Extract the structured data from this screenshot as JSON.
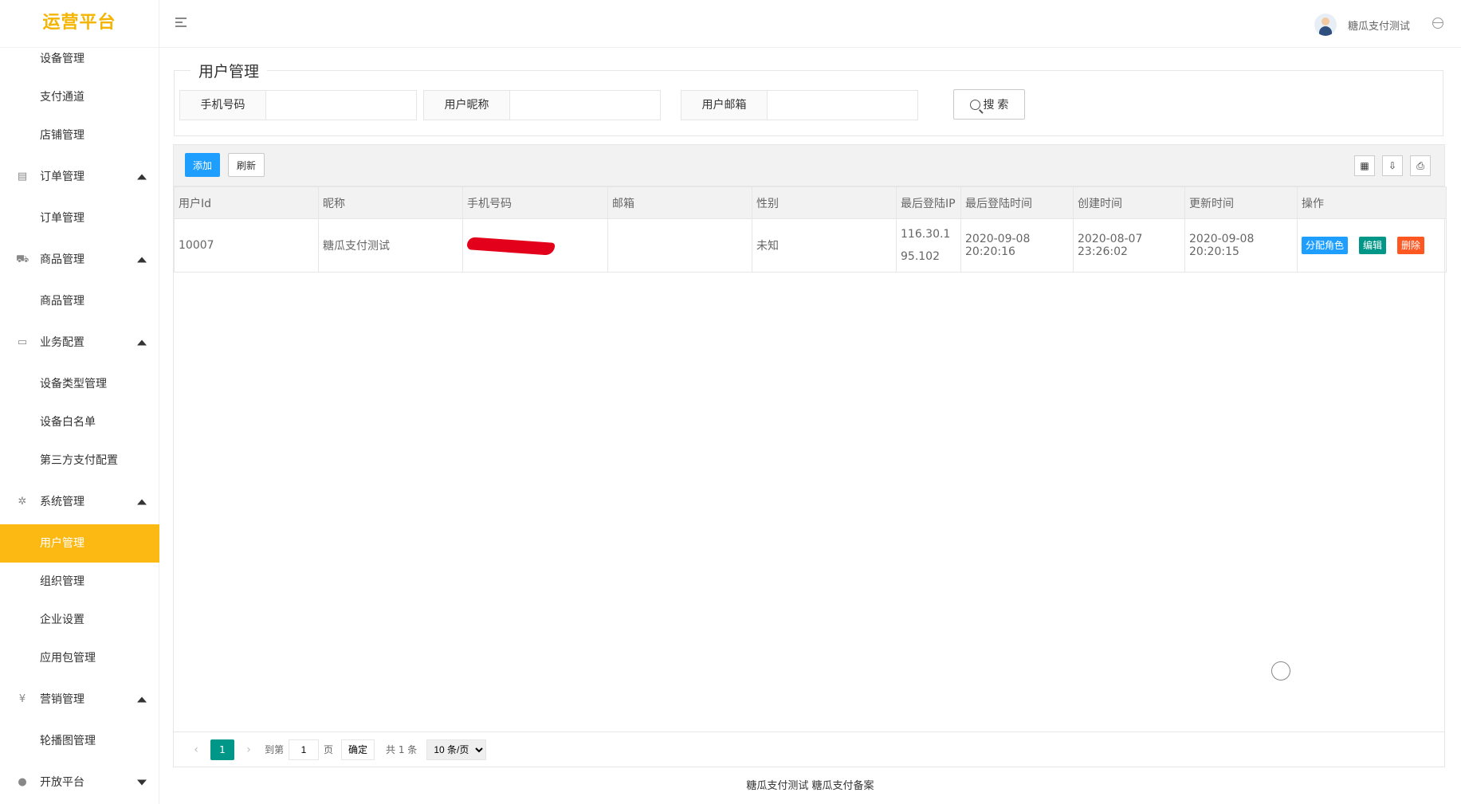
{
  "app": {
    "logo": "运营平台"
  },
  "header": {
    "username": "糖瓜支付测试"
  },
  "sidebar": {
    "items": [
      {
        "label": "设备管理",
        "type": "sub"
      },
      {
        "label": "支付通道",
        "type": "sub"
      },
      {
        "label": "店铺管理",
        "type": "sub"
      },
      {
        "label": "订单管理",
        "type": "group",
        "icon": "clipboard-icon",
        "arrow": "up"
      },
      {
        "label": "订单管理",
        "type": "sub"
      },
      {
        "label": "商品管理",
        "type": "group",
        "icon": "cart-icon",
        "arrow": "up"
      },
      {
        "label": "商品管理",
        "type": "sub"
      },
      {
        "label": "业务配置",
        "type": "group",
        "icon": "book-icon",
        "arrow": "up"
      },
      {
        "label": "设备类型管理",
        "type": "sub"
      },
      {
        "label": "设备白名单",
        "type": "sub"
      },
      {
        "label": "第三方支付配置",
        "type": "sub"
      },
      {
        "label": "系统管理",
        "type": "group",
        "icon": "gear-icon",
        "arrow": "up"
      },
      {
        "label": "用户管理",
        "type": "sub",
        "active": true
      },
      {
        "label": "组织管理",
        "type": "sub"
      },
      {
        "label": "企业设置",
        "type": "sub"
      },
      {
        "label": "应用包管理",
        "type": "sub"
      },
      {
        "label": "营销管理",
        "type": "group",
        "icon": "yen-icon",
        "arrow": "up"
      },
      {
        "label": "轮播图管理",
        "type": "sub"
      },
      {
        "label": "开放平台",
        "type": "group",
        "icon": "apple-icon",
        "arrow": "down"
      }
    ]
  },
  "search": {
    "legend": "用户管理",
    "phone_label": "手机号码",
    "nickname_label": "用户昵称",
    "email_label": "用户邮箱",
    "button": "搜 索"
  },
  "toolbar": {
    "add": "添加",
    "refresh": "刷新"
  },
  "table": {
    "columns": [
      "用户Id",
      "昵称",
      "手机号码",
      "邮箱",
      "性别",
      "最后登陆IP",
      "最后登陆时间",
      "创建时间",
      "更新时间",
      "操作"
    ],
    "rows": [
      {
        "id": "10007",
        "nickname": "糖瓜支付测试",
        "phone": "",
        "email": "",
        "gender": "未知",
        "last_ip": "116.30.195.102",
        "last_login": "2020-09-08 20:20:16",
        "created": "2020-08-07 23:26:02",
        "updated": "2020-09-08 20:20:15",
        "ops": {
          "assign_role": "分配角色",
          "edit": "编辑",
          "delete": "删除"
        }
      }
    ]
  },
  "pager": {
    "current": "1",
    "goto_label": "到第",
    "goto_value": "1",
    "page_unit": "页",
    "confirm": "确定",
    "total": "共 1 条",
    "page_size": "10 条/页"
  },
  "footer": {
    "text": "糖瓜支付测试 糖瓜支付备案"
  }
}
